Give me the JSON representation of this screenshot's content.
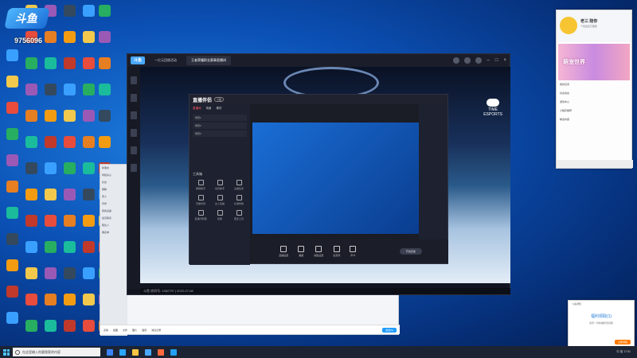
{
  "stream_overlay": {
    "logo_text": "斗鱼",
    "room_number": "9756096"
  },
  "desktop": {
    "icon_colors": [
      "#3aa0ff",
      "#f2c94c",
      "#e74c3c",
      "#27ae60",
      "#9b59b6",
      "#e67e22",
      "#1abc9c",
      "#34495e",
      "#f39c12",
      "#c0392b"
    ]
  },
  "main_window": {
    "tabs": [
      "一亿元回馈活动",
      "王者荣耀职业赛事直播间"
    ],
    "stage": {
      "brand_line1": "TIME",
      "brand_line2": "ESPORTS"
    },
    "status_text": "斗鱼 房间号: 1362797 | 2022-07-08"
  },
  "stream_client": {
    "logo": "直播伴侣",
    "pill": "斗鱼",
    "tabs": [
      "直播间",
      "场景",
      "素材"
    ],
    "scene_rows": [
      "场景1",
      "场景2",
      "场景3"
    ],
    "tools_heading": "工具箱",
    "tools": [
      "弹幕助手",
      "房管助手",
      "主播任务",
      "高能时刻",
      "达人直播",
      "礼物特效",
      "直播间管理",
      "投票",
      "更多工具"
    ],
    "bottom_buttons": [
      "直播设置",
      "美颜",
      "采集设置",
      "麦克风",
      "声卡"
    ],
    "start_label": "开始直播"
  },
  "qq_chat": {
    "contacts": [
      "新朋友",
      "特别关心",
      "好友",
      "群聊",
      "家人",
      "同学",
      "我的设备",
      "最近联系",
      "陌生人",
      "黑名单"
    ],
    "toolbar": [
      "表情",
      "截图",
      "文件",
      "图片",
      "语音",
      "消息记录"
    ],
    "send_label": "发送(S)"
  },
  "side_panel": {
    "name": "老三 陪你",
    "subtitle": "个性签名已更新",
    "banner_text": "萌宠世界",
    "rows": [
      "我的空间",
      "好友动态",
      "游戏中心",
      "小程序推荐",
      "精选内容"
    ]
  },
  "notification": {
    "title": "斗鱼通知",
    "main": "福利领取(1)",
    "sub": "您有一份新福利待领取",
    "button": "立即领取"
  },
  "taskbar": {
    "search_placeholder": "在这里输入你要搜索的内容",
    "tray_text": "中 英 17:01"
  }
}
